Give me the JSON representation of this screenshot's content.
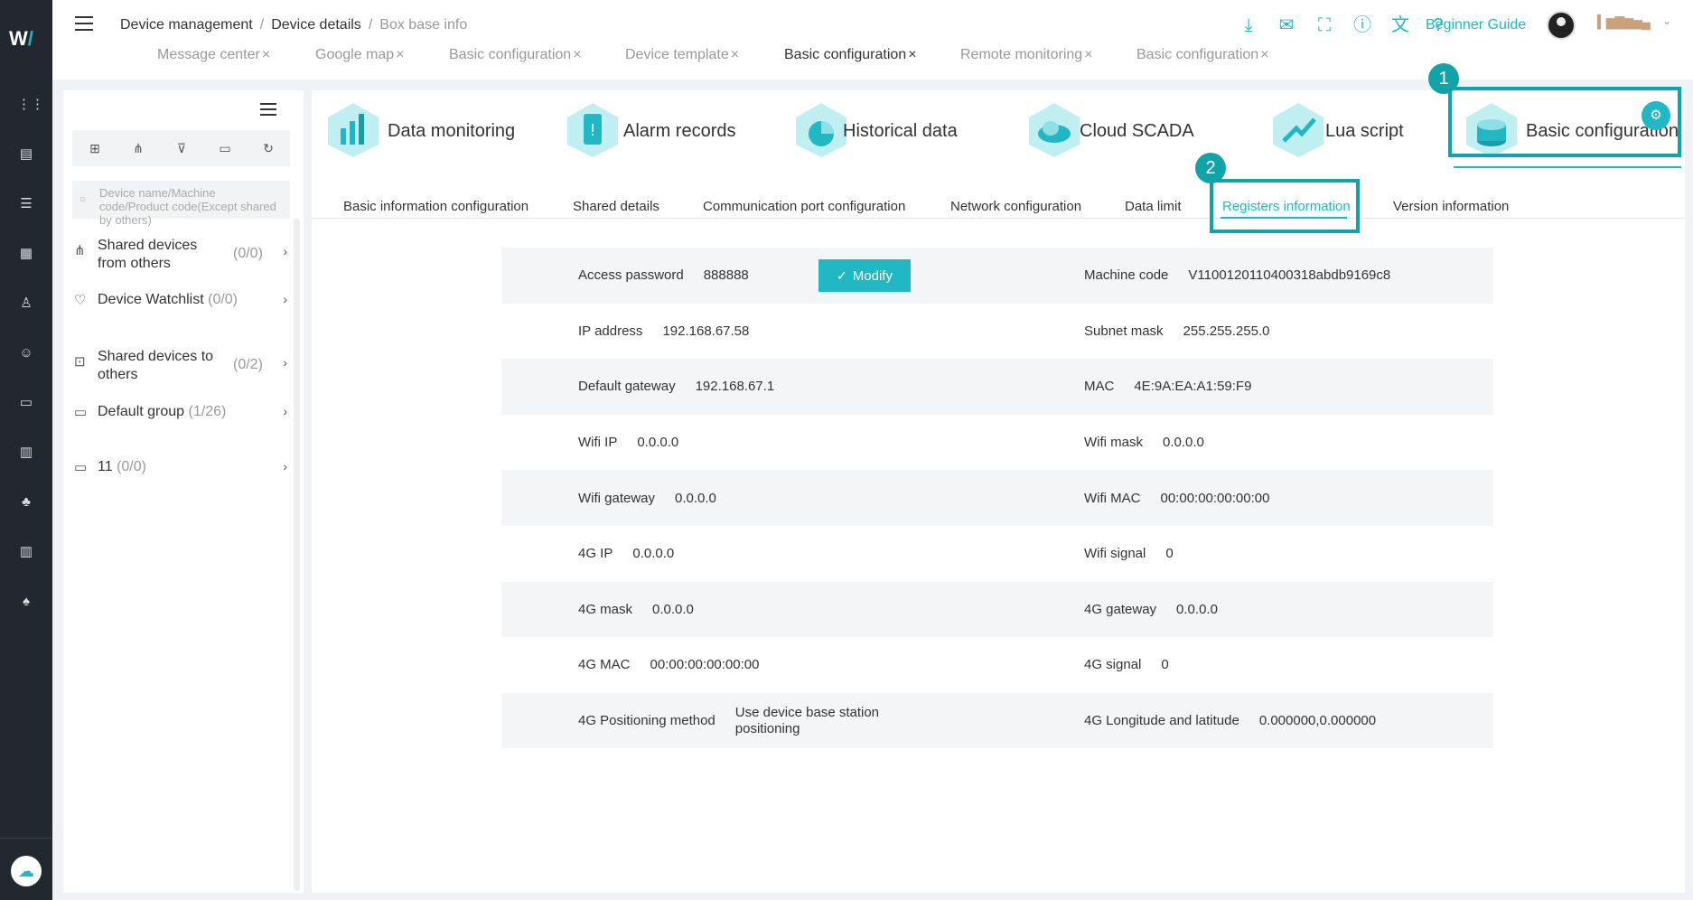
{
  "header": {
    "breadcrumb": [
      "Device management",
      "Device details",
      "Box base info"
    ],
    "guide_label": "Beginner Guide",
    "user_name": "▍▆▇▆▅▄"
  },
  "open_tabs": [
    {
      "label": "Message center"
    },
    {
      "label": "Google map"
    },
    {
      "label": "Basic configuration"
    },
    {
      "label": "Device template"
    },
    {
      "label": "Basic configuration"
    },
    {
      "label": "Remote monitoring"
    },
    {
      "label": "Basic configuration"
    }
  ],
  "sidebar": {
    "search_placeholder": "Device name/Machine code/Product code(Except shared by others)",
    "items": [
      {
        "label": "Shared devices from others",
        "count": "(0/0)"
      },
      {
        "label": "Device Watchlist",
        "count": "(0/0)"
      },
      {
        "label": "Shared devices to others",
        "count": "(0/2)"
      },
      {
        "label": "Default group",
        "count": "(1/26)"
      },
      {
        "label": "11",
        "count": "(0/0)"
      }
    ]
  },
  "features": [
    {
      "label": "Data monitoring"
    },
    {
      "label": "Alarm records"
    },
    {
      "label": "Historical data"
    },
    {
      "label": "Cloud SCADA"
    },
    {
      "label": "Lua script"
    },
    {
      "label": "Basic configuration"
    }
  ],
  "callouts": {
    "one": "1",
    "two": "2"
  },
  "subtabs": [
    {
      "label": "Basic information configuration"
    },
    {
      "label": "Shared details"
    },
    {
      "label": "Communication port configuration"
    },
    {
      "label": "Network configuration"
    },
    {
      "label": "Data limit"
    },
    {
      "label": "Registers information"
    },
    {
      "label": "Version information"
    }
  ],
  "modify_label": "Modify",
  "info_rows": [
    {
      "l1": "Access password",
      "v1": "888888",
      "l2": "Machine code",
      "v2": "V1100120110400318abdb9169c8"
    },
    {
      "l1": "IP address",
      "v1": "192.168.67.58",
      "l2": "Subnet mask",
      "v2": "255.255.255.0"
    },
    {
      "l1": "Default gateway",
      "v1": "192.168.67.1",
      "l2": "MAC",
      "v2": "4E:9A:EA:A1:59:F9"
    },
    {
      "l1": "Wifi IP",
      "v1": "0.0.0.0",
      "l2": "Wifi mask",
      "v2": "0.0.0.0"
    },
    {
      "l1": "Wifi gateway",
      "v1": "0.0.0.0",
      "l2": "Wifi MAC",
      "v2": "00:00:00:00:00:00"
    },
    {
      "l1": "4G IP",
      "v1": "0.0.0.0",
      "l2": "Wifi signal",
      "v2": "0"
    },
    {
      "l1": "4G mask",
      "v1": "0.0.0.0",
      "l2": "4G gateway",
      "v2": "0.0.0.0"
    },
    {
      "l1": "4G MAC",
      "v1": "00:00:00:00:00:00",
      "l2": "4G signal",
      "v2": "0"
    },
    {
      "l1": "4G Positioning method",
      "v1": "Use device base station positioning",
      "l2": "4G Longitude and latitude",
      "v2": "0.000000,0.000000"
    }
  ],
  "colors": {
    "accent": "#22b8c3",
    "callout": "#12a3a8",
    "rail": "#222730"
  }
}
